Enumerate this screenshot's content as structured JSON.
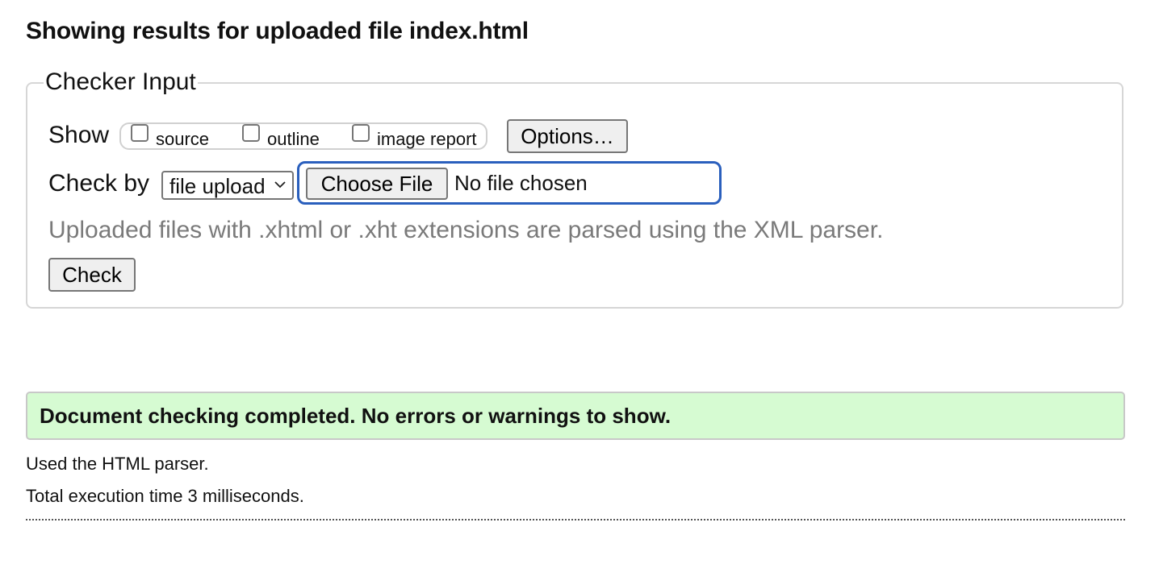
{
  "heading": "Showing results for uploaded file index.html",
  "checker": {
    "legend": "Checker Input",
    "show_label": "Show",
    "show_options": [
      {
        "label": "source",
        "checked": false
      },
      {
        "label": "outline",
        "checked": false
      },
      {
        "label": "image report",
        "checked": false
      }
    ],
    "options_button": "Options…",
    "check_by_label": "Check by",
    "check_by_value": "file upload",
    "choose_file_button": "Choose File",
    "file_status": "No file chosen",
    "hint": "Uploaded files with .xhtml or .xht extensions are parsed using the XML parser.",
    "check_button": "Check"
  },
  "result": {
    "message": "Document checking completed. No errors or warnings to show.",
    "color": "#d6fbd2"
  },
  "info": {
    "parser": "Used the HTML parser.",
    "execution_time": "Total execution time 3 milliseconds."
  },
  "colors": {
    "focus_ring": "#2a5fbd",
    "hint_text": "#7a7a7a"
  }
}
